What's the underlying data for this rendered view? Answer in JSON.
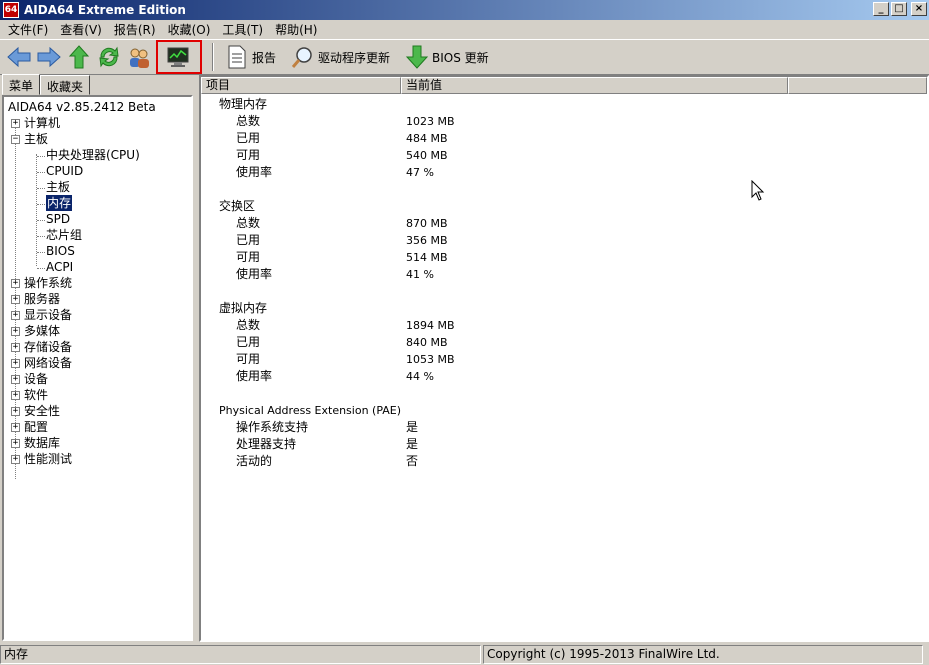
{
  "window": {
    "title": "AIDA64 Extreme Edition",
    "app_icon_text": "64"
  },
  "menu": [
    "文件(F)",
    "查看(V)",
    "报告(R)",
    "收藏(O)",
    "工具(T)",
    "帮助(H)"
  ],
  "toolbar": {
    "report_label": "报告",
    "driver_update_label": "驱动程序更新",
    "bios_update_label": "BIOS 更新"
  },
  "left_tabs": {
    "menu": "菜单",
    "favorites": "收藏夹"
  },
  "tree": {
    "root": "AIDA64 v2.85.2412 Beta",
    "computer": "计算机",
    "motherboard": "主板",
    "mb_children": [
      "中央处理器(CPU)",
      "CPUID",
      "主板",
      "内存",
      "SPD",
      "芯片组",
      "BIOS",
      "ACPI"
    ],
    "others": [
      "操作系统",
      "服务器",
      "显示设备",
      "多媒体",
      "存储设备",
      "网络设备",
      "设备",
      "软件",
      "安全性",
      "配置",
      "数据库",
      "性能测试"
    ]
  },
  "columns": {
    "item": "项目",
    "value": "当前值"
  },
  "sections": [
    {
      "title": "物理内存",
      "rows": [
        {
          "k": "总数",
          "v": "1023 MB"
        },
        {
          "k": "已用",
          "v": "484 MB"
        },
        {
          "k": "可用",
          "v": "540 MB"
        },
        {
          "k": "使用率",
          "v": "47 %"
        }
      ]
    },
    {
      "title": "交换区",
      "rows": [
        {
          "k": "总数",
          "v": "870 MB"
        },
        {
          "k": "已用",
          "v": "356 MB"
        },
        {
          "k": "可用",
          "v": "514 MB"
        },
        {
          "k": "使用率",
          "v": "41 %"
        }
      ]
    },
    {
      "title": "虚拟内存",
      "rows": [
        {
          "k": "总数",
          "v": "1894 MB"
        },
        {
          "k": "已用",
          "v": "840 MB"
        },
        {
          "k": "可用",
          "v": "1053 MB"
        },
        {
          "k": "使用率",
          "v": "44 %"
        }
      ]
    },
    {
      "title": "Physical Address Extension (PAE)",
      "rows": [
        {
          "k": "操作系统支持",
          "v": "是"
        },
        {
          "k": "处理器支持",
          "v": "是"
        },
        {
          "k": "活动的",
          "v": "否"
        }
      ]
    }
  ],
  "status": {
    "left": "内存",
    "right": "Copyright (c) 1995-2013 FinalWire Ltd."
  }
}
